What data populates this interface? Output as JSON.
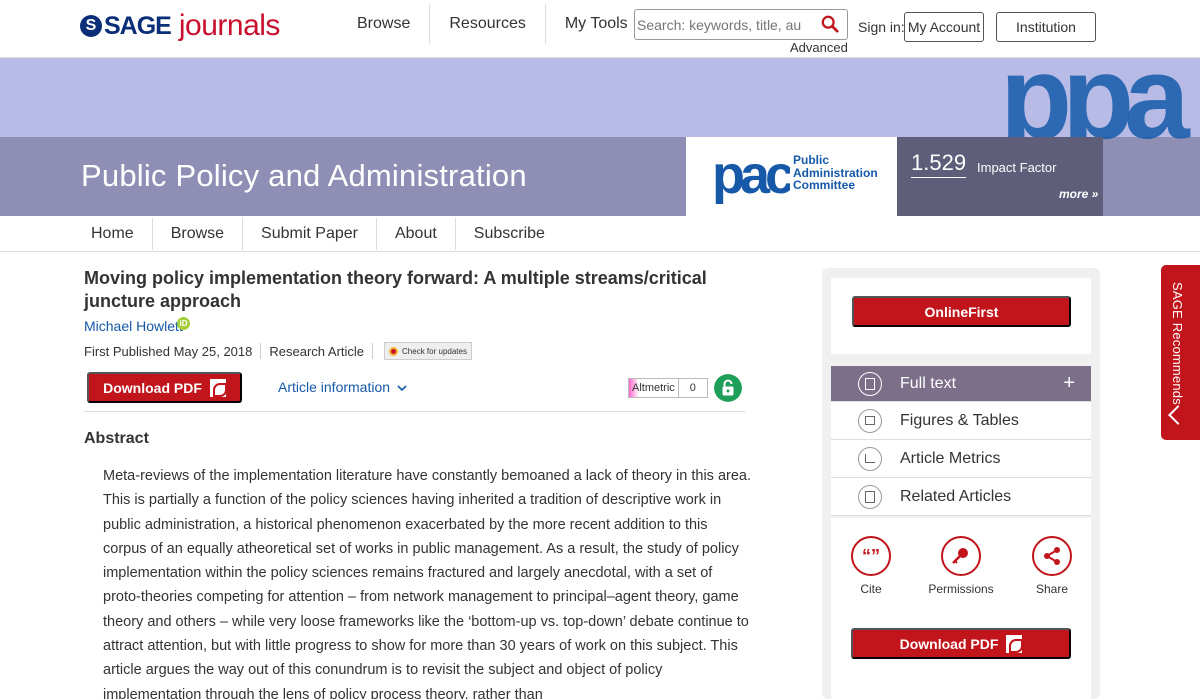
{
  "header": {
    "logo_sage": "SAGE",
    "logo_journals": "journals",
    "nav": [
      "Browse",
      "Resources",
      "My Tools"
    ],
    "search_placeholder": "Search: keywords, title, au",
    "advanced": "Advanced",
    "sign_in": "Sign in:",
    "my_account": "My Account",
    "institution": "Institution"
  },
  "banner": {
    "journal_title": "Public Policy and Administration",
    "pac_logo_letters": "pac",
    "pac_lines": [
      "Public",
      "Administration",
      "Committee"
    ],
    "ppa_logo_letters": "ppa",
    "impact_value": "1.529",
    "impact_label": "Impact Factor",
    "more": "more »"
  },
  "subnav": [
    "Home",
    "Browse",
    "Submit Paper",
    "About",
    "Subscribe"
  ],
  "article": {
    "title": "Moving policy implementation theory forward: A multiple streams/critical juncture approach",
    "author": "Michael Howlett",
    "first_published": "First Published May 25, 2018",
    "type": "Research Article",
    "check_updates": "Check for updates",
    "download_pdf": "Download PDF",
    "article_information": "Article information",
    "altmetric_label": "Altmetric",
    "altmetric_count": "0",
    "abstract_heading": "Abstract",
    "abstract_text": "Meta-reviews of the implementation literature have constantly bemoaned a lack of theory in this area. This is partially a function of the policy sciences having inherited a tradition of descriptive work in public administration, a historical phenomenon exacerbated by the more recent addition to this corpus of an equally atheoretical set of works in public management. As a result, the study of policy implementation within the policy sciences remains fractured and largely anecdotal, with a set of proto-theories competing for attention – from network management to principal–agent theory, game theory and others – while very loose frameworks like the ‘bottom-up vs. top-down’ debate continue to attract attention, but with little progress to show for more than 30 years of work on this subject. This article argues the way out of this conundrum is to revisit the subject and object of policy implementation through the lens of policy process theory, rather than"
  },
  "sidebar": {
    "online_first": "OnlineFirst",
    "toc": [
      "Full text",
      "Figures & Tables",
      "Article Metrics",
      "Related Articles"
    ],
    "actions": [
      "Cite",
      "Permissions",
      "Share"
    ],
    "download_pdf": "Download PDF",
    "recommends": "SAGE Recommends"
  },
  "colors": {
    "brand_red": "#c2141b",
    "brand_blue": "#0b2e78",
    "link_blue": "#1559a8",
    "banner_light": "#b7bbe6",
    "banner_dark": "#8f8fb6"
  }
}
